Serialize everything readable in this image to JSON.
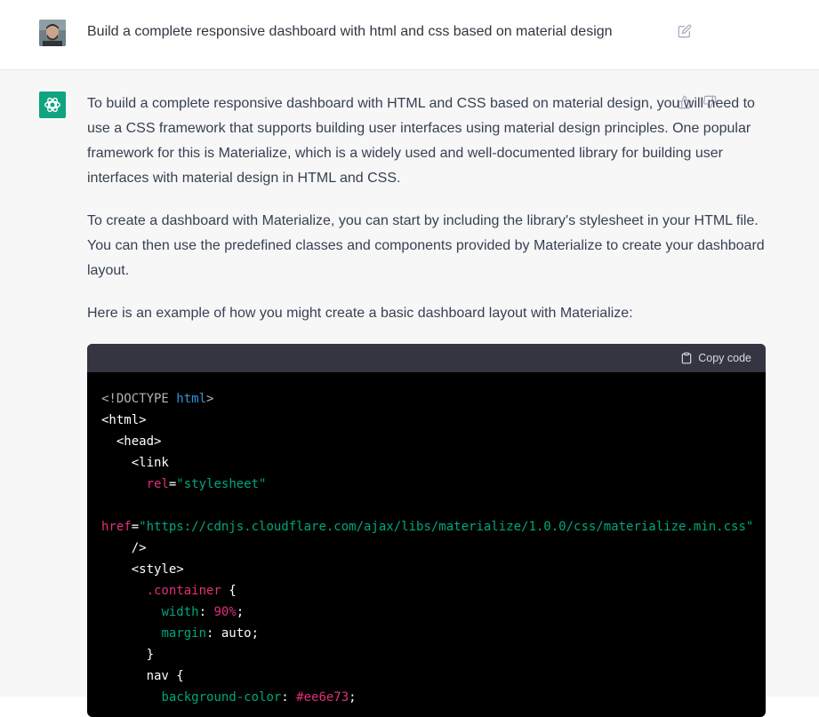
{
  "user_message": {
    "text": "Build a complete responsive dashboard with html and css based on material design",
    "avatar_icon": "user-photo",
    "edit_icon": "edit-icon"
  },
  "assistant_message": {
    "avatar_icon": "openai-logo",
    "paragraphs": [
      "To build a complete responsive dashboard with HTML and CSS based on material design, you will need to use a CSS framework that supports building user interfaces using material design principles. One popular framework for this is Materialize, which is a widely used and well-documented library for building user interfaces with material design in HTML and CSS.",
      "To create a dashboard with Materialize, you can start by including the library's stylesheet in your HTML file. You can then use the predefined classes and components provided by Materialize to create your dashboard layout.",
      "Here is an example of how you might create a basic dashboard layout with Materialize:"
    ],
    "feedback": {
      "thumbs_up_icon": "thumbs-up-icon",
      "thumbs_down_icon": "thumbs-down-icon"
    }
  },
  "code_block": {
    "copy_label": "Copy code",
    "lines": [
      {
        "indent": "",
        "tokens": [
          {
            "t": "<!DOCTYPE ",
            "c": "t-gray"
          },
          {
            "t": "html",
            "c": "t-blue"
          },
          {
            "t": ">",
            "c": "t-gray"
          }
        ]
      },
      {
        "indent": "",
        "tokens": [
          {
            "t": "<html>",
            "c": "t-white"
          }
        ]
      },
      {
        "indent": "  ",
        "tokens": [
          {
            "t": "<head>",
            "c": "t-white"
          }
        ]
      },
      {
        "indent": "    ",
        "tokens": [
          {
            "t": "<link",
            "c": "t-white"
          }
        ]
      },
      {
        "indent": "      ",
        "tokens": [
          {
            "t": "rel",
            "c": "t-red"
          },
          {
            "t": "=",
            "c": "t-white"
          },
          {
            "t": "\"stylesheet\"",
            "c": "t-green"
          }
        ]
      },
      {
        "indent": "",
        "tokens": []
      },
      {
        "indent": "",
        "tokens": [
          {
            "t": "href",
            "c": "t-red"
          },
          {
            "t": "=",
            "c": "t-white"
          },
          {
            "t": "\"https://cdnjs.cloudflare.com/ajax/libs/materialize/1.0.0/css/materialize.min.css\"",
            "c": "t-green"
          }
        ]
      },
      {
        "indent": "    ",
        "tokens": [
          {
            "t": "/>",
            "c": "t-white"
          }
        ]
      },
      {
        "indent": "    ",
        "tokens": [
          {
            "t": "<style>",
            "c": "t-white"
          }
        ]
      },
      {
        "indent": "      ",
        "tokens": [
          {
            "t": ".container",
            "c": "t-red"
          },
          {
            "t": " {",
            "c": "t-white"
          }
        ]
      },
      {
        "indent": "        ",
        "tokens": [
          {
            "t": "width",
            "c": "t-green"
          },
          {
            "t": ": ",
            "c": "t-white"
          },
          {
            "t": "90%",
            "c": "t-red"
          },
          {
            "t": ";",
            "c": "t-white"
          }
        ]
      },
      {
        "indent": "        ",
        "tokens": [
          {
            "t": "margin",
            "c": "t-green"
          },
          {
            "t": ": auto;",
            "c": "t-white"
          }
        ]
      },
      {
        "indent": "      ",
        "tokens": [
          {
            "t": "}",
            "c": "t-white"
          }
        ]
      },
      {
        "indent": "      ",
        "tokens": [
          {
            "t": "nav {",
            "c": "t-white"
          }
        ]
      },
      {
        "indent": "        ",
        "tokens": [
          {
            "t": "background-color",
            "c": "t-green"
          },
          {
            "t": ": ",
            "c": "t-white"
          },
          {
            "t": "#ee6e73",
            "c": "t-red"
          },
          {
            "t": ";",
            "c": "t-white"
          }
        ]
      }
    ]
  }
}
